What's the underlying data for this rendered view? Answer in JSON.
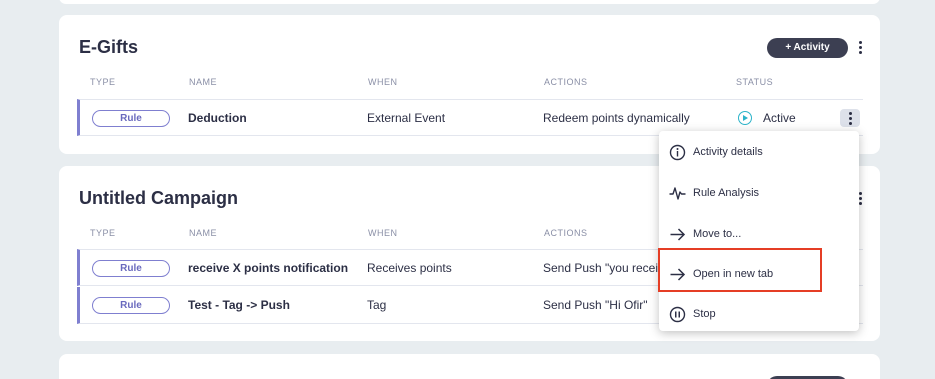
{
  "campaigns": [
    {
      "title": "E-Gifts",
      "activity_button": "+ Activity",
      "headers": {
        "type": "TYPE",
        "name": "NAME",
        "when": "WHEN",
        "actions": "ACTIONS",
        "status": "STATUS"
      },
      "rows": [
        {
          "type": "Rule",
          "name": "Deduction",
          "when": "External Event",
          "actions": "Redeem points dynamically",
          "status": "Active"
        }
      ]
    },
    {
      "title": "Untitled Campaign",
      "headers": {
        "type": "TYPE",
        "name": "NAME",
        "when": "WHEN",
        "actions": "ACTIONS"
      },
      "rows": [
        {
          "type": "Rule",
          "name": "receive X points notification",
          "when": "Receives points",
          "actions": "Send Push \"you recei"
        },
        {
          "type": "Rule",
          "name": "Test - Tag -> Push",
          "when": "Tag",
          "actions": "Send Push \"Hi Ofir\""
        }
      ]
    }
  ],
  "context_menu": {
    "items": [
      {
        "label": "Activity details",
        "icon": "info-icon"
      },
      {
        "label": "Rule Analysis",
        "icon": "pulse-icon"
      },
      {
        "label": "Move to...",
        "icon": "arrow-right-icon"
      },
      {
        "label": "Open in new tab",
        "icon": "arrow-right-icon"
      },
      {
        "label": "Stop",
        "icon": "pause-icon"
      }
    ]
  },
  "colors": {
    "accent": "#7f7fd0",
    "active": "#2bb3c9",
    "dark_button": "#3c3f52",
    "highlight": "#e53d25"
  }
}
